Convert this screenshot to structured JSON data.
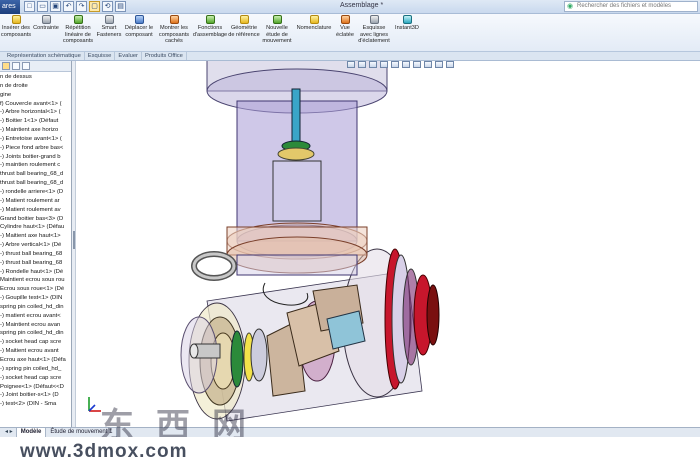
{
  "titlebar": {
    "app_button": "ares",
    "window_title": "Assemblage *",
    "search_placeholder": "Rechercher des fichiers et modèles",
    "qat": [
      "□",
      "▭",
      "▣",
      "↶",
      "↷",
      "▢",
      "⟲",
      "▤"
    ]
  },
  "ribbon": {
    "buttons": [
      {
        "label": "Insérer des composants",
        "color": "yellow"
      },
      {
        "label": "Contrainte",
        "color": "gray"
      },
      {
        "label": "Répétition linéaire de composants",
        "color": "green"
      },
      {
        "label": "Smart Fasteners",
        "color": "gray"
      },
      {
        "label": "Déplacer le composant",
        "color": "blue"
      },
      {
        "label": "Montrer les composants cachés",
        "color": "orange"
      },
      {
        "label": "Fonctions d'assemblage",
        "color": "green"
      },
      {
        "label": "Géométrie de référence",
        "color": "yellow"
      },
      {
        "label": "Nouvelle étude de mouvement",
        "color": "green"
      },
      {
        "label": "Nomenclature",
        "color": "yellow"
      },
      {
        "label": "Vue éclatée",
        "color": "orange"
      },
      {
        "label": "Esquisse avec lignes d'éclatement",
        "color": "gray"
      },
      {
        "label": "Instant3D",
        "color": "cyan"
      }
    ]
  },
  "command_tabs": [
    "Représentation schématique",
    "Esquisse",
    "Evaluer",
    "Produits Office"
  ],
  "feature_tree": {
    "items": [
      "n de dessus",
      "n de droite",
      "gine",
      "f) Couvercle avant<1> (",
      "-) Arbre horizontal<1> (",
      "-) Boitier 1<1> (Défaut",
      "-) Maintient axe horizo",
      "-) Entretoise avant<1> (",
      "-) Piece fond arbre bas<",
      "-) Joints boitier-grand b",
      "-) maintien roulement c",
      "thrust ball bearing_68_d",
      "thrust ball bearing_68_d",
      "-) rondelle arriere<1> (D",
      "-) Matient roulement ar",
      "-) Matient roulement av",
      "Grand boitier bas<3> (D",
      "Cylindre haut<1> (Défau",
      "-) Maitient axe haut<1>",
      "-) Arbre vertical<1> (Dé",
      "-) thrust ball bearing_68",
      "-) thrust ball bearing_68",
      "-) Rondelle haut<1> (Dé",
      "Maintient ecrou sous rou",
      "Ecrou sous roue<1> (Dé",
      "-) Goupille test<1> (DIN",
      "spring pin coiled_hd_din",
      "-) matient ecrou avant<",
      "-) Maintient ecrou avan",
      "spring pin coiled_hd_din",
      "-) socket head cap scre",
      "-) Maitient ecrou avant",
      "Ecrou axe haut<1> (Défa",
      "-) spring pin coiled_hd_",
      "-) socket head cap scre",
      "Poignee<1> (Défaut<<D",
      "-) Joint boitier-s<1> (D",
      "-) test<2> (DIN - Sma"
    ]
  },
  "bottom_tabs": {
    "nav": "◂ ▸",
    "tabs": [
      "Modèle",
      "Étude de mouvement 1"
    ]
  },
  "watermark": {
    "url": "www.3dmox.com",
    "cn": "东西网"
  }
}
